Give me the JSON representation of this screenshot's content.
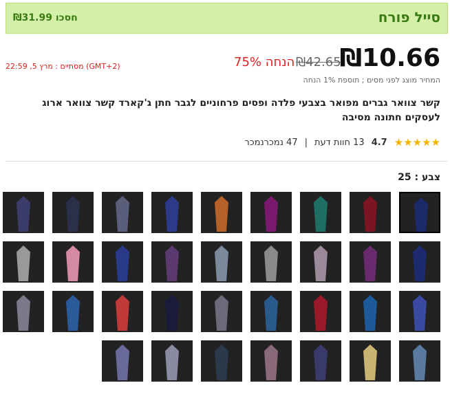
{
  "banner": {
    "title": "סייל פורח",
    "save": "חסכו ₪31.99"
  },
  "price": {
    "current": "₪10.66",
    "original": "₪42.65",
    "discount": "75% הנחה",
    "ends": "מסתיים : מרץ 5, 22:59 (GMT+2)",
    "note": "המחיר מוצג לפני מסים ; תוספת 1% הנחה"
  },
  "product": {
    "title": "קשר צוואר גברים מפואר בצבעי פלדה ופסים פרחוניים לגבר חתן ג'קארד קשר צוואר ארוג לעסקים חתונה מסיבה"
  },
  "rating": {
    "score": "4.7",
    "reviews": "13 חוות דעת",
    "sold": "47 נמכרנמכר"
  },
  "color": {
    "label": "צבע : 25"
  },
  "swatches": [
    {
      "color": "#1c2a6a"
    },
    {
      "color": "#7b1524"
    },
    {
      "color": "#1e6e64"
    },
    {
      "color": "#7a1a6e"
    },
    {
      "color": "#b5622a"
    },
    {
      "color": "#2d3a8a"
    },
    {
      "color": "#5a5e7a"
    },
    {
      "color": "#2a2f4a"
    },
    {
      "color": "#3c3c6a"
    },
    {
      "color": "#1d2a6e"
    },
    {
      "color": "#6a2a6e"
    },
    {
      "color": "#9a8a9a"
    },
    {
      "color": "#8a8a8a"
    },
    {
      "color": "#7a8a9a"
    },
    {
      "color": "#5a3a6e"
    },
    {
      "color": "#2a3a8a"
    },
    {
      "color": "#d48aa0"
    },
    {
      "color": "#999999"
    },
    {
      "color": "#3a4aa0"
    },
    {
      "color": "#1e5a9a"
    },
    {
      "color": "#9a1a2a"
    },
    {
      "color": "#2a5a8a"
    },
    {
      "color": "#6a6a7a"
    },
    {
      "color": "#1a1a3a"
    },
    {
      "color": "#c03a3a"
    },
    {
      "color": "#2a5a9a"
    },
    {
      "color": "#7a7a8a"
    },
    {
      "color": "#5a7aa0"
    },
    {
      "color": "#c8b470"
    },
    {
      "color": "#3a3a6a"
    },
    {
      "color": "#8a6a7a"
    },
    {
      "color": "#2a3a4a"
    },
    {
      "color": "#8a8aa0"
    },
    {
      "color": "#6a6a9a"
    },
    {
      "color": "#d8a820"
    },
    {
      "color": "#7a8aa0"
    },
    {
      "color": "#8a6a8a"
    },
    {
      "color": "#6a6a6a"
    }
  ]
}
